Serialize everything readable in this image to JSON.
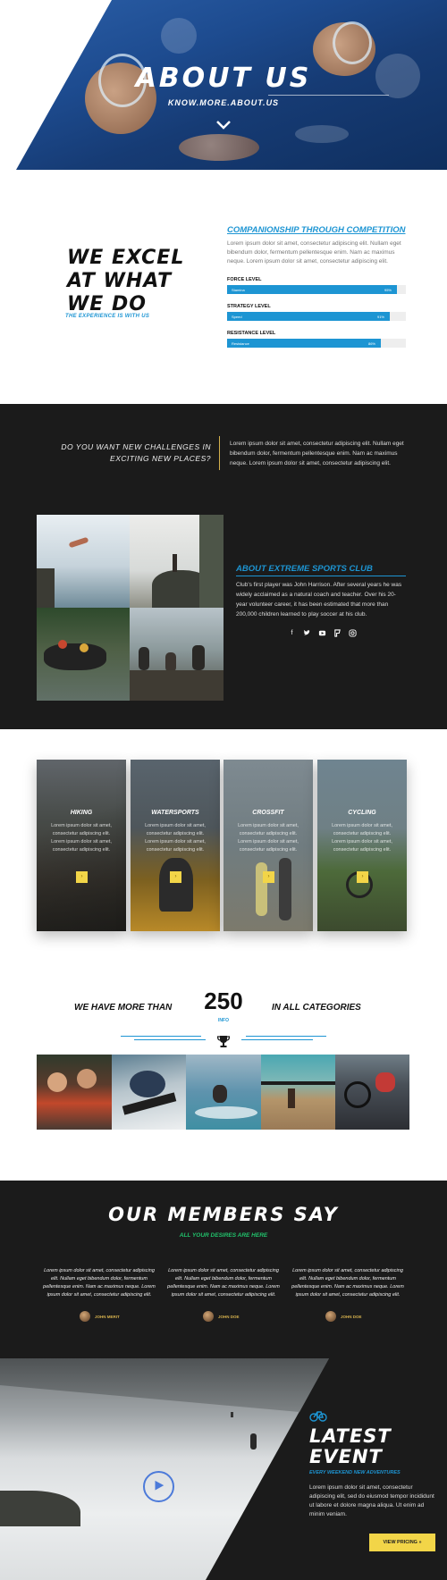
{
  "hero": {
    "title": "ABOUT US",
    "subtitle": "KNOW.MORE.ABOUT.US"
  },
  "excel": {
    "title": "WE EXCEL AT WHAT WE DO",
    "subtitle": "THE EXPERIENCE IS WITH US"
  },
  "companionship": {
    "title": "COMPANIONSHIP THROUGH COMPETITION",
    "text": "Lorem ipsum dolor sit amet, consectetur adipiscing elit. Nullam eget bibendum dolor, fermentum pellentesque enim. Nam ac maximus neque. Lorem ipsum dolor sit amet, consectetur adipiscing elit.",
    "bars": [
      {
        "label": "FORCE LEVEL",
        "name": "Stamina",
        "percent": "95%",
        "value": 0.95
      },
      {
        "label": "STRATEGY LEVEL",
        "name": "Speed",
        "percent": "91%",
        "value": 0.91
      },
      {
        "label": "RESISTANCE LEVEL",
        "name": "Resistance",
        "percent": "86%",
        "value": 0.86
      }
    ]
  },
  "challenge": {
    "question": "DO YOU WANT NEW CHALLENGES IN EXCITING NEW PLACES?",
    "text": "Lorem ipsum dolor sit amet, consectetur adipiscing elit. Nullam eget bibendum dolor, fermentum pellentesque enim. Nam ac maximus neque. Lorem ipsum dolor sit amet, consectetur adipiscing elit."
  },
  "club": {
    "title": "ABOUT EXTREME SPORTS CLUB",
    "text": "Club's first player was John Harrison. After several years he was widely acclaimed as a natural coach and teacher. Over his 20-year volunteer career, it has been estimated that more than 200,000 children learned to play soccer at his club.",
    "socials": [
      "facebook-icon",
      "twitter-icon",
      "youtube-icon",
      "foursquare-icon",
      "instagram-icon"
    ]
  },
  "cards": [
    {
      "title": "HIKING",
      "text": "Lorem ipsum dolor sit amet, consectetur adipiscing elit. Lorem ipsum dolor sit amet, consectetur adipiscing elit.",
      "button": "›"
    },
    {
      "title": "WATERSPORTS",
      "text": "Lorem ipsum dolor sit amet, consectetur adipiscing elit. Lorem ipsum dolor sit amet, consectetur adipiscing elit.",
      "button": "›"
    },
    {
      "title": "CROSSFIT",
      "text": "Lorem ipsum dolor sit amet, consectetur adipiscing elit. Lorem ipsum dolor sit amet, consectetur adipiscing elit.",
      "button": "›"
    },
    {
      "title": "CYCLING",
      "text": "Lorem ipsum dolor sit amet, consectetur adipiscing elit. Lorem ipsum dolor sit amet, consectetur adipiscing elit.",
      "button": "›"
    }
  ],
  "stats": {
    "left": "WE HAVE MORE THAN",
    "number": "250",
    "unit": "INFO",
    "right": "IN ALL CATEGORIES"
  },
  "testimonials": {
    "title": "OUR MEMBERS SAY",
    "subtitle": "ALL YOUR DESIRES ARE HERE",
    "items": [
      {
        "text": "Lorem ipsum dolor sit amet, consectetur adipiscing elit. Nullam eget bibendum dolor, fermentum pellentesque enim. Nam ac maximus neque. Lorem ipsum dolor sit amet, consectetur adipiscing elit.",
        "author": "JOHN MERIT"
      },
      {
        "text": "Lorem ipsum dolor sit amet, consectetur adipiscing elit. Nullam eget bibendum dolor, fermentum pellentesque enim. Nam ac maximus neque. Lorem ipsum dolor sit amet, consectetur adipiscing elit.",
        "author": "JOHN DOE"
      },
      {
        "text": "Lorem ipsum dolor sit amet, consectetur adipiscing elit. Nullam eget bibendum dolor, fermentum pellentesque enim. Nam ac maximus neque. Lorem ipsum dolor sit amet, consectetur adipiscing elit.",
        "author": "JOHN DOE"
      }
    ]
  },
  "event": {
    "title": "LATEST EVENT",
    "subtitle": "EVERY WEEKEND NEW ADVENTURES",
    "text": "Lorem ipsum dolor sit amet, consectetur adipiscing elit, sed do eiusmod tempor incididunt ut labore et dolore magna aliqua. Ut enim ad minim veniam.",
    "button": "VIEW PRICING »"
  },
  "colors": {
    "accent": "#1d95d3",
    "gold": "#f2d548",
    "green": "#21c26b",
    "dark": "#1b1b1b"
  }
}
